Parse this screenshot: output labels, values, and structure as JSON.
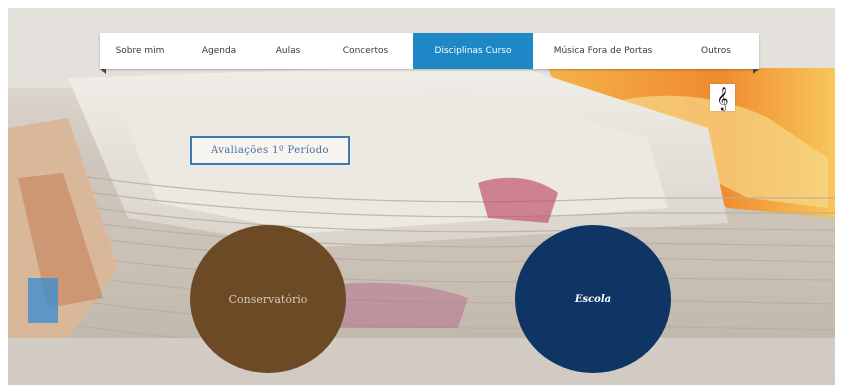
{
  "nav": {
    "items": [
      {
        "label": "Sobre mim"
      },
      {
        "label": "Agenda"
      },
      {
        "label": "Aulas"
      },
      {
        "label": "Concertos"
      },
      {
        "label": "Disciplinas Curso"
      },
      {
        "label": "Música Fora de Portas"
      },
      {
        "label": "Outros"
      }
    ],
    "active_index": 4
  },
  "clef": {
    "glyph": "𝄞",
    "icon": "treble-clef-icon"
  },
  "assessments": {
    "label": "Avaliações 1º Período"
  },
  "circles": {
    "conservatorio": {
      "label": "Conservatório"
    },
    "escola": {
      "label": "Escola"
    }
  },
  "colors": {
    "nav_active": "#1e88c7",
    "conservatorio": "#6b4a25",
    "escola": "#0f3565",
    "button_border": "#3e78b0"
  }
}
